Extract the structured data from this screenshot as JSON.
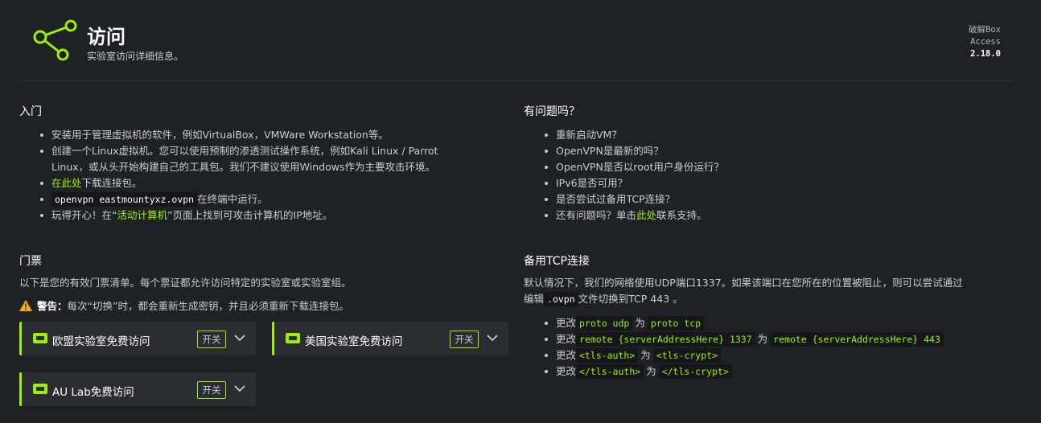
{
  "header": {
    "title": "访问",
    "subtitle": "实验室访问详细信息。",
    "version_line1": "破解Box",
    "version_line2": "Access",
    "version_number": "2.18.0"
  },
  "getting_started": {
    "heading": "入门",
    "item1": "安装用于管理虚拟机的软件，例如VirtualBox，VMWare Workstation等。",
    "item2_line1": "创建一个Linux虚拟机。您可以使用预制的渗透测试操作系统，例如Kali Linux / Parrot",
    "item2_line2": "Linux，或从头开始构建自己的工具包。我们不建议使用Windows作为主要攻击环境。",
    "item3_link": "在此处",
    "item3_rest": "下载连接包。",
    "item4_code": "openvpn eastmountyxz.ovpn",
    "item4_rest": "在终端中运行。",
    "item5_pre": "玩得开心！在“",
    "item5_link": "活动计算机",
    "item5_post": "”页面上找到可攻击计算机的IP地址。"
  },
  "questions": {
    "heading": "有问题吗？",
    "item1": "重新启动VM？",
    "item2": "OpenVPN是最新的吗？",
    "item3": "OpenVPN是否以root用户身份运行？",
    "item4": "IPv6是否可用？",
    "item5": "是否尝试过备用TCP连接？",
    "item6_pre": "还有问题吗？单击",
    "item6_link": "此处",
    "item6_post": "联系支持。"
  },
  "tickets": {
    "heading": "门票",
    "description": "以下是您的有效门票清单。每个票证都允许访问特定的实验室或实验室组。",
    "warning_label": "警告：",
    "warning_text": "每次“切换”时，都会重新生成密钥，并且必须重新下载连接包。",
    "cards": [
      {
        "name": "欧盟实验室免费访问",
        "toggle": "开关"
      },
      {
        "name": "美国实验室免费访问",
        "toggle": "开关"
      },
      {
        "name": "AU Lab免费访问",
        "toggle": "开关"
      }
    ]
  },
  "tcp": {
    "heading": "备用TCP连接",
    "para_line1": "默认情况下，我们的网络使用UDP端口1337。如果该端口在您所在的位置被阻止，则可以尝试通过",
    "para_line2_pre": "编辑",
    "para_line2_code": ".ovpn",
    "para_line2_post": "文件切换到TCP 443 。",
    "change_word": "更改",
    "to_word": "为",
    "changes": [
      {
        "from": "proto udp",
        "to": "proto tcp"
      },
      {
        "from": "remote {serverAddressHere} 1337",
        "to": "remote {serverAddressHere} 443"
      },
      {
        "from": "<tls-auth>",
        "to": "<tls-crypt>"
      },
      {
        "from": "</tls-auth>",
        "to": "</tls-crypt>"
      }
    ]
  },
  "colors": {
    "accent": "#9fef00",
    "background": "#1f2225",
    "card": "#2a2e33",
    "warning": "#ffaf00"
  },
  "icons": {
    "logo": "share-nodes-icon",
    "warning": "warning-triangle-icon",
    "ticket": "ticket-icon",
    "chevron": "chevron-down-icon"
  }
}
